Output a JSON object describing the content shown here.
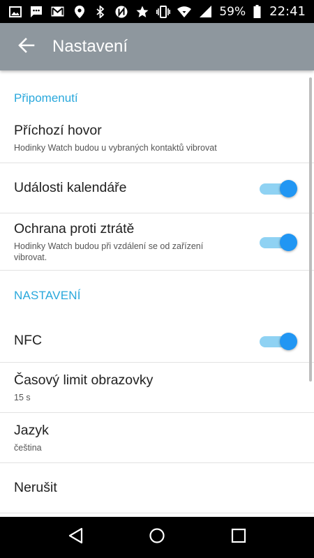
{
  "status_bar": {
    "battery_percent": "59%",
    "time": "22:41",
    "left_icons": [
      "image-icon",
      "chat-icon",
      "gmail-icon"
    ],
    "right_icons": [
      "location-icon",
      "bluetooth-icon",
      "nfc-icon",
      "star-icon",
      "vibrate-icon",
      "wifi-icon",
      "signal-icon",
      "battery-icon"
    ]
  },
  "app_bar": {
    "title": "Nastavení",
    "background": "#8e979e"
  },
  "sections": [
    {
      "header": "Připomenutí",
      "items": [
        {
          "title": "Příchozí hovor",
          "subtitle": "Hodinky Watch budou u vybraných kontaktů vibrovat"
        },
        {
          "title": "Události kalendáře",
          "toggle": true
        },
        {
          "title": "Ochrana proti ztrátě",
          "subtitle": "Hodinky Watch budou při vzdálení se od zařízení vibrovat.",
          "toggle": true
        }
      ]
    },
    {
      "header": "NASTAVENÍ",
      "items": [
        {
          "title": "NFC",
          "toggle": true
        },
        {
          "title": "Časový limit obrazovky",
          "subtitle": "15 s"
        },
        {
          "title": "Jazyk",
          "subtitle": "čeština"
        },
        {
          "title": "Nerušit"
        }
      ]
    }
  ],
  "colors": {
    "accent": "#29a8dc",
    "toggle_thumb": "#2196f3",
    "toggle_track": "#8fd2f3"
  },
  "nav_bar": {
    "buttons": [
      "back-triangle-icon",
      "home-circle-icon",
      "recents-square-icon"
    ]
  }
}
